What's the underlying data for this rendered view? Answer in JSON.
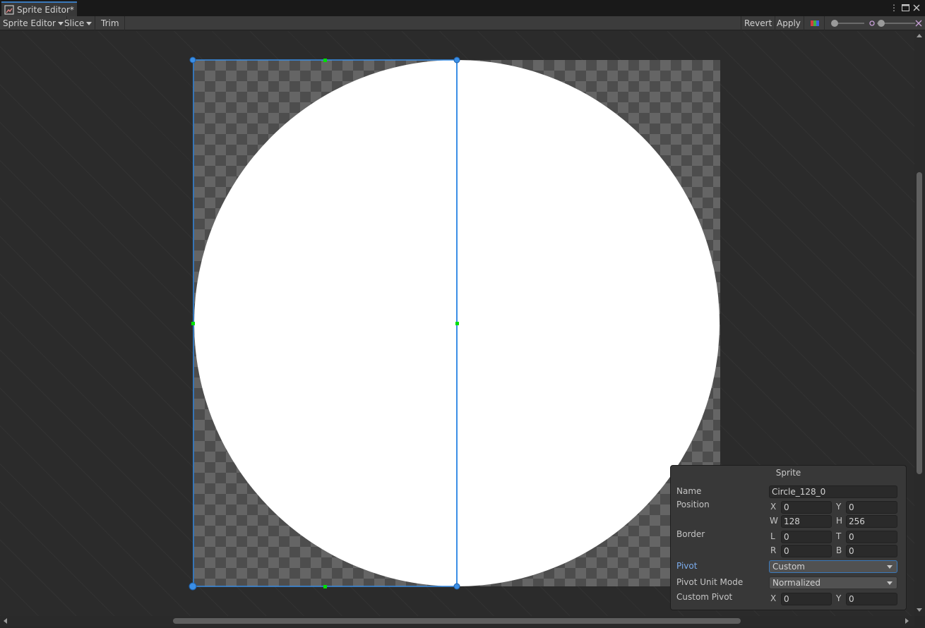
{
  "window": {
    "tab_title": "Sprite Editor*",
    "icons": [
      "sprite-editor-icon",
      "more-vert-icon",
      "maximize-icon",
      "close-icon"
    ]
  },
  "toolbar": {
    "mode_label": "Sprite Editor",
    "slice_label": "Slice",
    "trim_label": "Trim",
    "revert_label": "Revert",
    "apply_label": "Apply",
    "color_toggle_icon": "color-channel-icon",
    "zoom_icon": "zoom-icon"
  },
  "canvas": {
    "sprite_name": "Circle_128",
    "selection_color": "#3a8ee6",
    "handle_color": "#00ff00"
  },
  "sprite_panel": {
    "title": "Sprite",
    "name_label": "Name",
    "name_value": "Circle_128_0",
    "position_label": "Position",
    "x_label": "X",
    "x_value": "0",
    "y_label": "Y",
    "y_value": "0",
    "w_label": "W",
    "w_value": "128",
    "h_label": "H",
    "h_value": "256",
    "border_label": "Border",
    "l_label": "L",
    "l_value": "0",
    "t_label": "T",
    "t_value": "0",
    "r_label": "R",
    "r_value": "0",
    "b_label": "B",
    "b_value": "0",
    "pivot_label": "Pivot",
    "pivot_value": "Custom",
    "pivot_unit_label": "Pivot Unit Mode",
    "pivot_unit_value": "Normalized",
    "custom_pivot_label": "Custom Pivot",
    "cp_x_label": "X",
    "cp_x_value": "0",
    "cp_y_label": "Y",
    "cp_y_value": "0"
  },
  "colors": {
    "accent": "#3a79bb",
    "pivot_label_active": "#7cacec"
  }
}
